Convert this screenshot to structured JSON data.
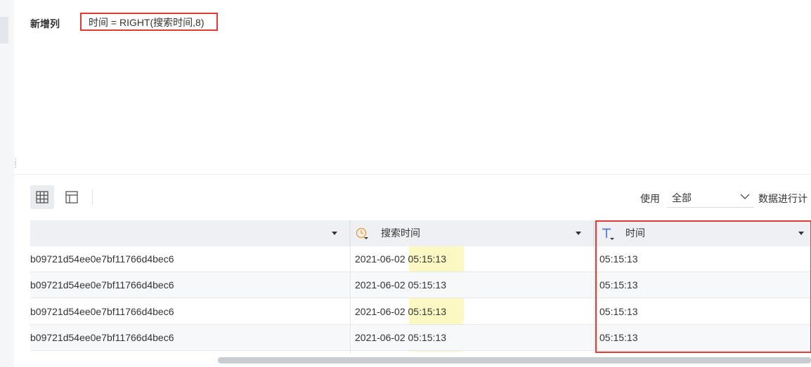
{
  "formula": {
    "label": "新增列",
    "expression": "时间 = RIGHT(搜索时间,8)"
  },
  "toolbar": {
    "view_buttons": [
      {
        "icon": "grid-view-icon",
        "active": true
      },
      {
        "icon": "layout-view-icon",
        "active": false
      }
    ],
    "use_label": "使用",
    "use_select_value": "全部",
    "calc_label": "数据进行计"
  },
  "table": {
    "columns": [
      {
        "type_icon": "",
        "name": ""
      },
      {
        "type_icon": "clock-icon",
        "name": "搜索时间"
      },
      {
        "type_icon": "text-type-icon",
        "name": "时间"
      }
    ],
    "rows": [
      [
        "b09721d54ee0e7bf11766d4bec6",
        "2021-06-02 05:15:13",
        "05:15:13"
      ],
      [
        "b09721d54ee0e7bf11766d4bec6",
        "2021-06-02 05:15:13",
        "05:15:13"
      ],
      [
        "b09721d54ee0e7bf11766d4bec6",
        "2021-06-02 05:15:13",
        "05:15:13"
      ],
      [
        "b09721d54ee0e7bf11766d4bec6",
        "2021-06-02 05:15:13",
        "05:15:13"
      ]
    ]
  },
  "colors": {
    "highlight_border": "#e53935",
    "selection_fill": "#fbf8c4",
    "header_bg": "#eef0f4",
    "clock_icon": "#f0a040",
    "text_type_icon": "#4a6bd6"
  }
}
